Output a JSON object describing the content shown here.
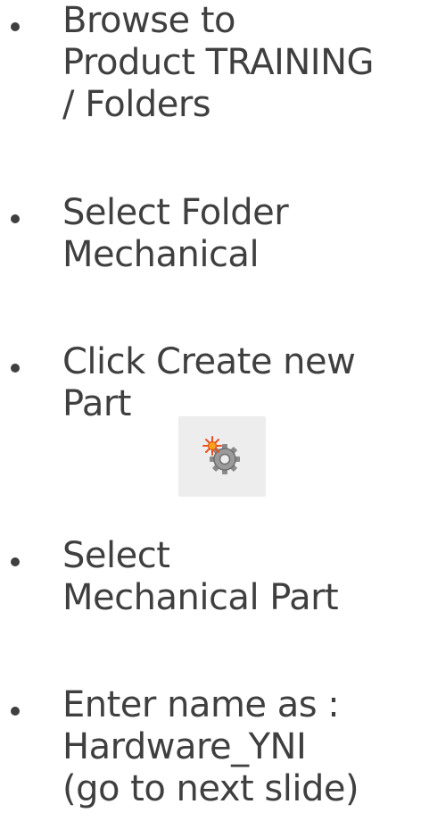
{
  "slide": {
    "bullets": [
      {
        "lines": [
          "Browse to",
          "Product TRAINING",
          "/ Folders"
        ]
      },
      {
        "lines": [
          "Select Folder",
          "Mechanical"
        ]
      },
      {
        "lines": [
          "Click Create new",
          "Part"
        ]
      },
      {
        "lines": [
          "Select",
          "Mechanical Part"
        ]
      },
      {
        "lines": [
          "Enter name as :",
          "Hardware_YNI",
          "(go to next slide)"
        ]
      }
    ],
    "create_part_icon": "gear-new-icon",
    "colors": {
      "text": "#3f3f3f",
      "icon_bg": "#ededed",
      "gear": "#8a8a8a",
      "sparkle": "#e8531f"
    }
  }
}
